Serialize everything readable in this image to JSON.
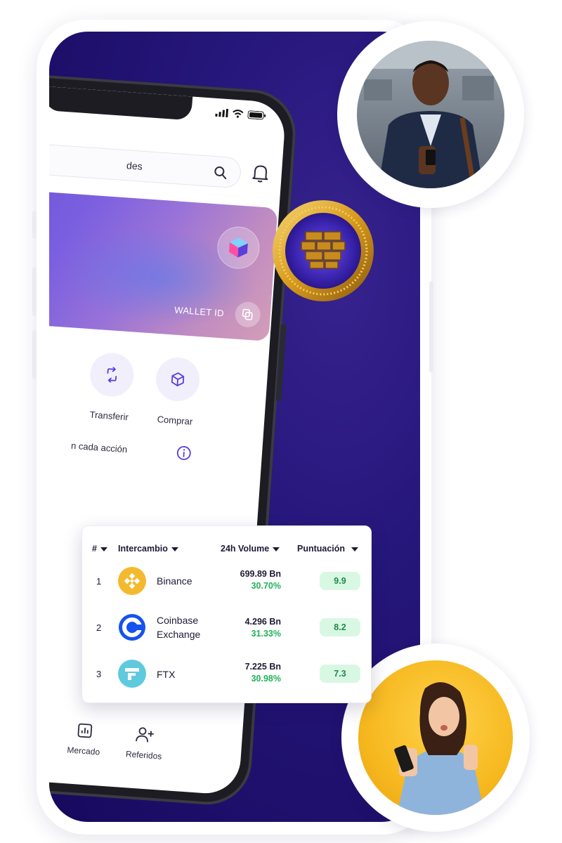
{
  "phone": {
    "search_text": "des",
    "wallet_label": "WALLET ID",
    "actions": [
      {
        "label": "Transferir",
        "icon": "transfer-icon"
      },
      {
        "label": "Comprar",
        "icon": "cube-icon"
      }
    ],
    "info_text": "n cada acción",
    "nav": [
      {
        "label": "Mercado",
        "icon": "chart-icon"
      },
      {
        "label": "Referidos",
        "icon": "add-user-icon"
      }
    ]
  },
  "table": {
    "headers": {
      "rank": "#",
      "exchange": "Intercambio",
      "volume": "24h Volume",
      "score": "Puntuación"
    },
    "rows": [
      {
        "rank": "1",
        "name_line1": "Binance",
        "name_line2": "",
        "volume": "699.89 Bn",
        "change": "30.70%",
        "score": "9.9",
        "logo": "binance-logo",
        "logo_color": "#F3BA2F"
      },
      {
        "rank": "2",
        "name_line1": "Coinbase",
        "name_line2": "Exchange",
        "volume": "4.296 Bn",
        "change": "31.33%",
        "score": "8.2",
        "logo": "coinbase-logo",
        "logo_color": "#1652F0"
      },
      {
        "rank": "3",
        "name_line1": "FTX",
        "name_line2": "",
        "volume": "7.225 Bn",
        "change": "30.98%",
        "score": "7.3",
        "logo": "ftx-logo",
        "logo_color": "#5FCADE"
      }
    ]
  },
  "colors": {
    "panel": "#1B0C62",
    "accent": "#5B3FD9",
    "positive": "#20B25A",
    "score_bg": "#D8F8E3",
    "coin_gold": "#E2A92A"
  }
}
